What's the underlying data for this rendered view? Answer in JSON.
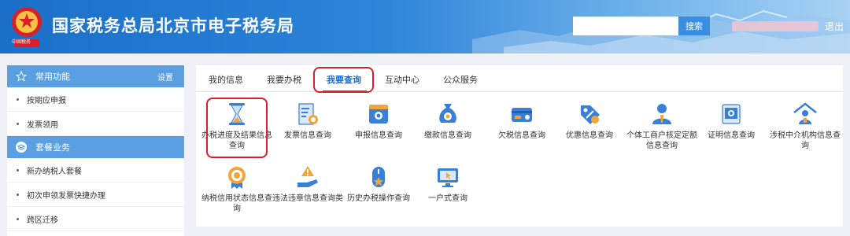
{
  "header": {
    "emblem_text": "中国税务",
    "title": "国家税务总局北京市电子税务局",
    "search_placeholder": "",
    "search_button": "搜索",
    "logout": "退出"
  },
  "sidebar": {
    "sections": [
      {
        "label": "常用功能",
        "action": "设置",
        "items": [
          "按期应申报",
          "发票领用"
        ]
      },
      {
        "label": "套餐业务",
        "items": [
          "新办纳税人套餐",
          "初次申领发票快捷办理",
          "跨区迁移"
        ]
      }
    ]
  },
  "main": {
    "tabs": [
      "我的信息",
      "我要办税",
      "我要查询",
      "互动中心",
      "公众服务"
    ],
    "active_tab": "我要查询",
    "tiles": [
      {
        "label": "办税进度及结果信息查询",
        "icon": "hourglass-icon"
      },
      {
        "label": "发票信息查询",
        "icon": "invoice-icon"
      },
      {
        "label": "申报信息查询",
        "icon": "declaration-icon"
      },
      {
        "label": "缴款信息查询",
        "icon": "payment-bag-icon"
      },
      {
        "label": "欠税信息查询",
        "icon": "arrears-card-icon"
      },
      {
        "label": "优惠信息查询",
        "icon": "discount-tag-icon"
      },
      {
        "label": "个体工商户核定定额信息查询",
        "icon": "business-person-icon"
      },
      {
        "label": "证明信息查询",
        "icon": "certificate-icon"
      },
      {
        "label": "涉税中介机构信息查询",
        "icon": "agency-house-icon"
      },
      {
        "label": "纳税信用状态信息查询",
        "icon": "credit-medal-icon"
      },
      {
        "label": "违法违章信息查询类",
        "icon": "warning-hand-icon"
      },
      {
        "label": "历史办税操作查询",
        "icon": "history-mouse-icon"
      },
      {
        "label": "一户式查询",
        "icon": "monitor-cursor-icon"
      }
    ]
  },
  "colors": {
    "header_blue": "#1a6fc7",
    "sidebar_header": "#5a9fe2",
    "active_tab": "#1e6fd1",
    "highlight_red": "#d8202a",
    "icon_orange": "#f2a33a"
  }
}
